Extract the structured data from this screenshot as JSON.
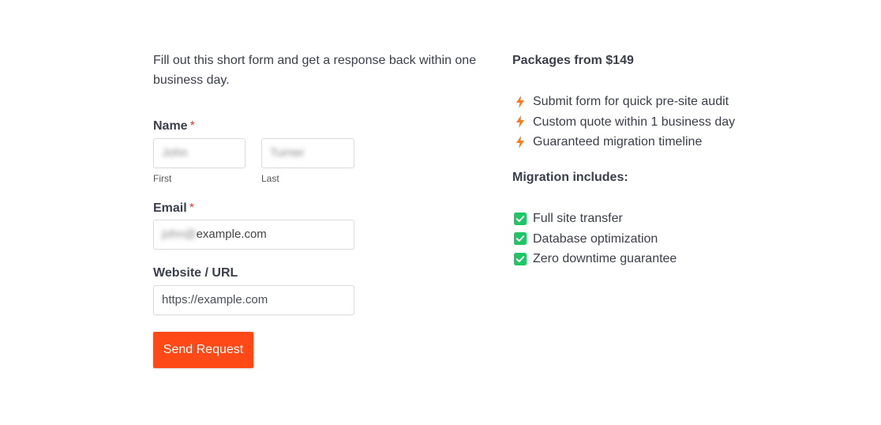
{
  "intro": "Fill out this short form and get a response back within one business day.",
  "form": {
    "name_label": "Name",
    "required_mark": "*",
    "first_value": "John",
    "last_value": "Turner",
    "first_sublabel": "First",
    "last_sublabel": "Last",
    "email_label": "Email",
    "email_value_blurred": "john@",
    "email_value_domain": "example.com",
    "website_label": "Website / URL",
    "website_value": "https://example.com",
    "submit_label": "Send Request",
    "submit_color": "#ff4a17"
  },
  "packages": {
    "heading": "Packages from $149",
    "items": [
      "Submit form for quick pre-site audit",
      "Custom quote within 1 business day",
      "Guaranteed migration timeline"
    ],
    "icon": "lightning-bolt-icon",
    "icon_color": "#f47b20"
  },
  "migration": {
    "heading": "Migration includes:",
    "items": [
      "Full site transfer",
      "Database optimization",
      "Zero downtime guarantee"
    ],
    "icon": "checkbox-checked-icon",
    "icon_color": "#1ec764"
  }
}
